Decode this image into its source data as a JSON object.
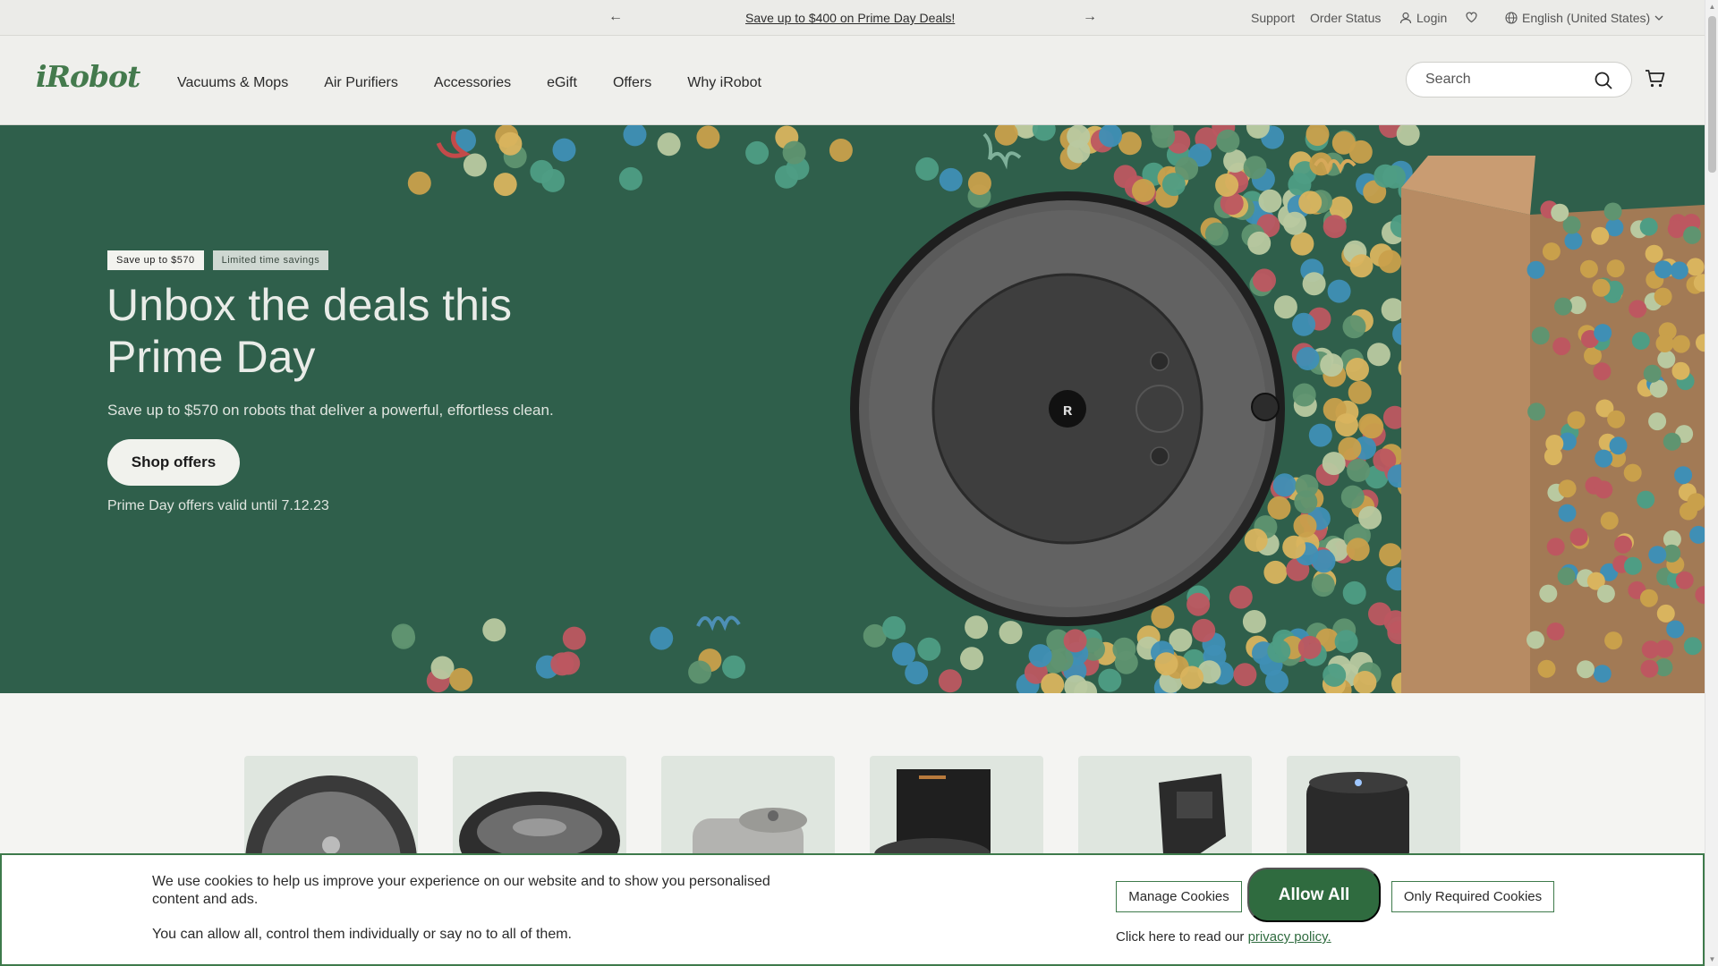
{
  "announcement": {
    "promo_link": "Save up to $400 on Prime Day Deals!",
    "support": "Support",
    "order_status": "Order Status",
    "login": "Login",
    "language": "English (United States)"
  },
  "header": {
    "logo": "iRobot",
    "nav": [
      "Vacuums & Mops",
      "Air Purifiers",
      "Accessories",
      "eGift",
      "Offers",
      "Why iRobot"
    ],
    "search_placeholder": "Search"
  },
  "hero": {
    "badge_primary": "Save up to $570",
    "badge_secondary": "Limited time savings",
    "headline": "Unbox the deals this Prime Day",
    "subtext": "Save up to $570 on robots that deliver a powerful, effortless clean.",
    "cta": "Shop offers",
    "validity": "Prime Day offers valid until 7.12.23"
  },
  "products": {
    "count": 6
  },
  "cookie_banner": {
    "message": "We use cookies to help us improve your experience on our website and to show you personalised content and ads.",
    "message2": "You can allow all, control them individually or say no to all of them.",
    "manage": "Manage Cookies",
    "allow_all": "Allow All",
    "only_required": "Only Required Cookies",
    "privacy_prefix": "Click here to read our ",
    "privacy_link": "privacy policy."
  },
  "colors": {
    "brand_green": "#447a4d",
    "hero_bg": "#2f5f4b",
    "allow_button": "#2f6b3f"
  }
}
